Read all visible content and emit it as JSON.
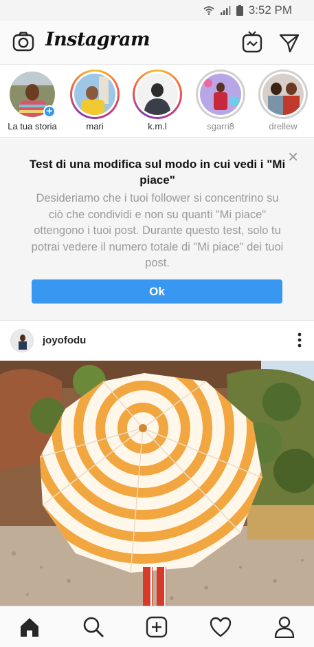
{
  "status_bar": {
    "time": "3:52 PM"
  },
  "header": {
    "logo": "Instagram"
  },
  "stories": [
    {
      "name": "La tua storia",
      "state": "own"
    },
    {
      "name": "mari",
      "state": "new"
    },
    {
      "name": "k.m.l",
      "state": "new"
    },
    {
      "name": "sgarri8",
      "state": "seen"
    },
    {
      "name": "drellew",
      "state": "seen"
    }
  ],
  "notice": {
    "title": "Test di una modifica sul modo in cui vedi i \"Mi piace\"",
    "body": "Desideriamo che i tuoi follower si concentrino su ciò che condividi e non su quanti \"Mi piace\" ottengono i tuoi post. Durante questo test, solo tu potrai vedere il numero totale di \"Mi piace\" dei tuoi post.",
    "button": "Ok"
  },
  "post": {
    "username": "joyofodu"
  },
  "colors": {
    "accent": "#3897f0"
  }
}
